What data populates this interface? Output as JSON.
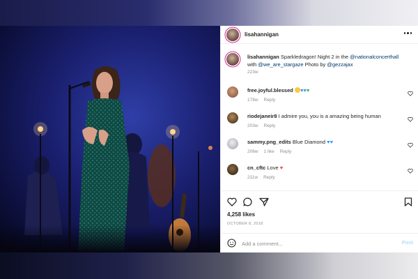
{
  "post": {
    "username": "lisahannigan",
    "more_icon": "more-horizontal-icon"
  },
  "caption": {
    "username": "lisahannigan",
    "text_part1": " Sparkledragon! Night 2 in the ",
    "mention1": "@nationalconcerthall",
    "text_part2": " with ",
    "mention2": "@we_are_stargaze",
    "text_part3": " Photo by ",
    "mention3": "@gezzajax",
    "time": "223w"
  },
  "comments": [
    {
      "username": "free.joyful.blessed",
      "text": "",
      "emoji": [
        "smile",
        "blue-heart",
        "blue-heart",
        "green-heart"
      ],
      "time": "178w",
      "likes": "",
      "reply": "Reply",
      "avatar_color": "#7a4a3a"
    },
    {
      "username": "riodejaneir8",
      "text": "I admire you, you is a amazing being human",
      "emoji": [],
      "time": "203w",
      "likes": "",
      "reply": "Reply",
      "avatar_color": "#5a3a1a"
    },
    {
      "username": "sammy.png_edits",
      "text": "Blue Diamond",
      "emoji": [
        "blue-heart",
        "blue-heart"
      ],
      "time": "206w",
      "likes": "1 like",
      "reply": "Reply",
      "avatar_color": "#c8c8cc"
    },
    {
      "username": "cn_cftc",
      "text": "Love",
      "emoji": [
        "red-heart"
      ],
      "time": "211w",
      "likes": "",
      "reply": "Reply",
      "avatar_color": "#3a2a1a"
    }
  ],
  "actions": {
    "like_icon": "heart-icon",
    "comment_icon": "comment-icon",
    "share_icon": "share-icon",
    "save_icon": "bookmark-icon"
  },
  "likes": "4,258 likes",
  "date": "OCTOBER 8, 2018",
  "comment_input": {
    "placeholder": "Add a comment...",
    "post_label": "Post"
  },
  "repost": {
    "username": "gezzajax"
  },
  "colors": {
    "accent": "#0095f6",
    "mention": "#00376b",
    "muted": "#8e8e8e"
  }
}
